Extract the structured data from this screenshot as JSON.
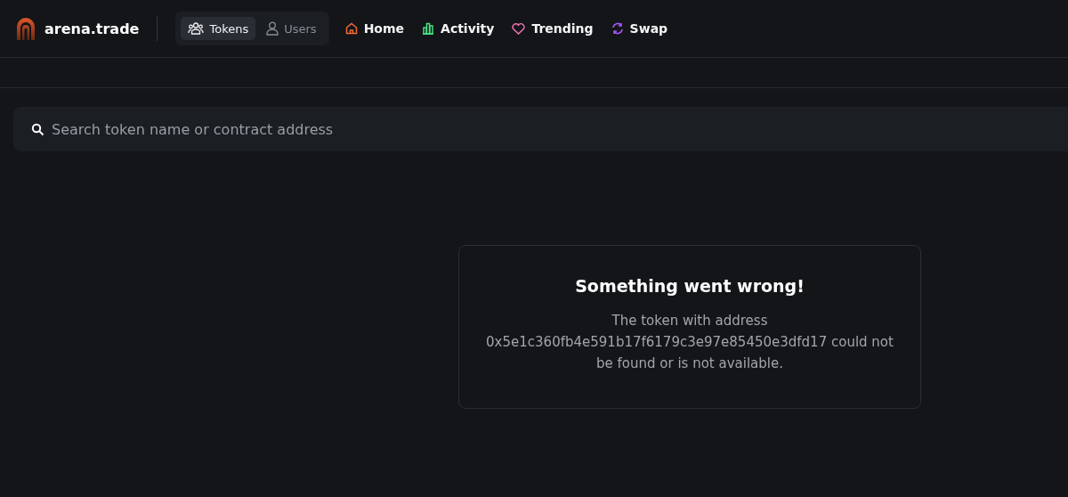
{
  "brand": {
    "name": "arena.trade"
  },
  "toggle": [
    {
      "label": "Tokens",
      "kind": "tokens",
      "selected": true
    },
    {
      "label": "Users",
      "kind": "users",
      "selected": false
    }
  ],
  "nav": [
    {
      "label": "Home",
      "kind": "home",
      "color": "#f26b3a"
    },
    {
      "label": "Activity",
      "kind": "activity",
      "color": "#4ade80"
    },
    {
      "label": "Trending",
      "kind": "trending",
      "color": "#f472b6"
    },
    {
      "label": "Swap",
      "kind": "swap",
      "color": "#a855f7"
    }
  ],
  "search": {
    "placeholder": "Search token name or contract address"
  },
  "error": {
    "title": "Something went wrong!",
    "message": "The token with address 0x5e1c360fb4e591b17f6179c3e97e85450e3dfd17 could not be found or is not available."
  }
}
